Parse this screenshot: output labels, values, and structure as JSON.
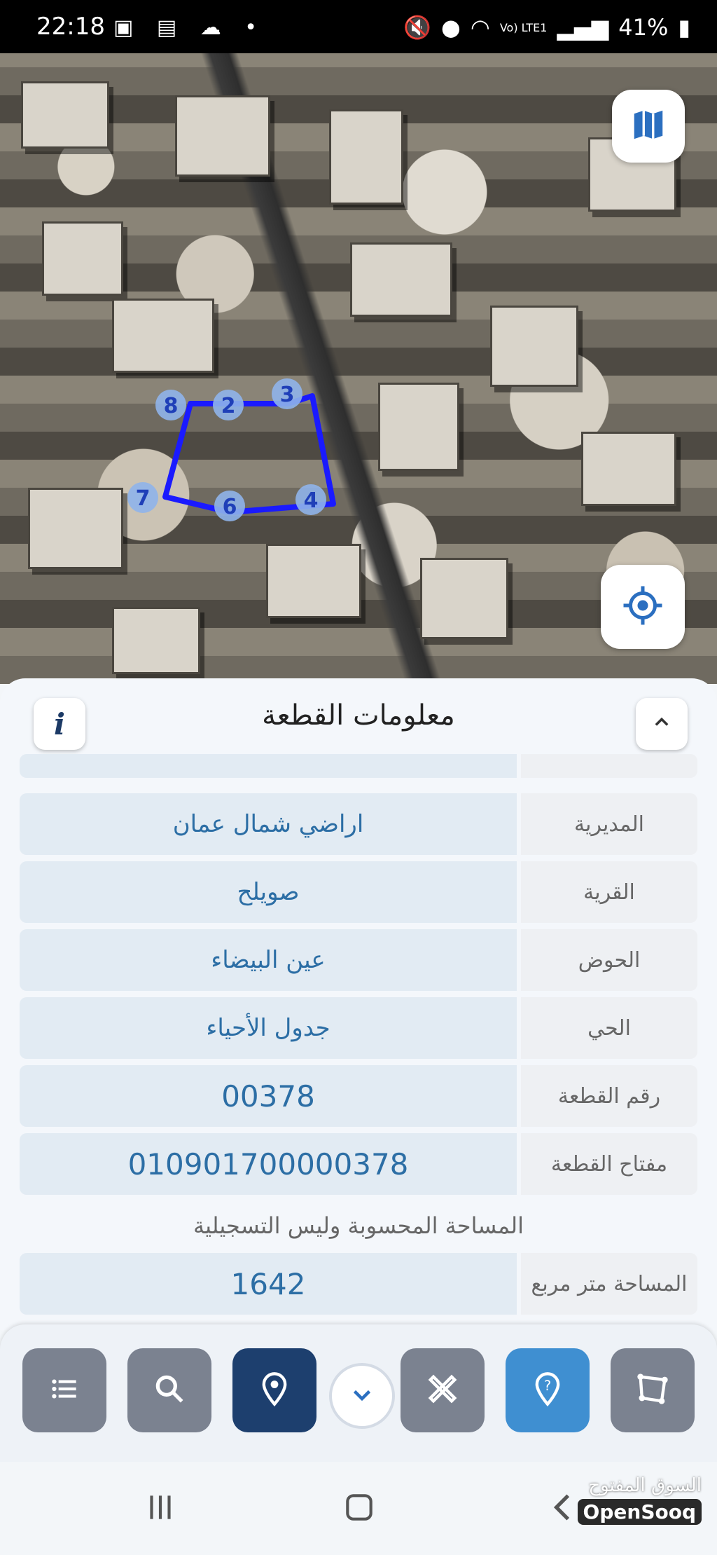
{
  "status_bar": {
    "time": "22:18",
    "battery": "41%",
    "network": "Vo) LTE1"
  },
  "map": {
    "parcel_vertices": [
      "8",
      "2",
      "3",
      "4",
      "6",
      "7"
    ],
    "layer_icon": "map-icon",
    "locate_icon": "crosshair-icon",
    "parcel_color": "#1a1aff"
  },
  "panel": {
    "title": "معلومات القطعة",
    "info_label": "i",
    "rows": [
      {
        "label": "المديرية",
        "value": "اراضي شمال عمان"
      },
      {
        "label": "القرية",
        "value": "صويلح"
      },
      {
        "label": "الحوض",
        "value": "عين البيضاء"
      },
      {
        "label": "الحي",
        "value": "جدول الأحياء"
      },
      {
        "label": "رقم القطعة",
        "value": "00378"
      },
      {
        "label": "مفتاح القطعة",
        "value": "010901700000378"
      }
    ],
    "note": "المساحة المحسوبة وليس التسجيلية",
    "area_row": {
      "label": "المساحة متر مربع",
      "value": "1642"
    }
  },
  "toolbar": {
    "tools": [
      "list-icon",
      "search-icon",
      "location-pin-icon",
      "chevron-down-icon",
      "ruler-pencil-icon",
      "help-icon",
      "polygon-icon"
    ]
  },
  "watermark": {
    "arabic": "السوق المفتوح",
    "english": "OpenSooq"
  }
}
